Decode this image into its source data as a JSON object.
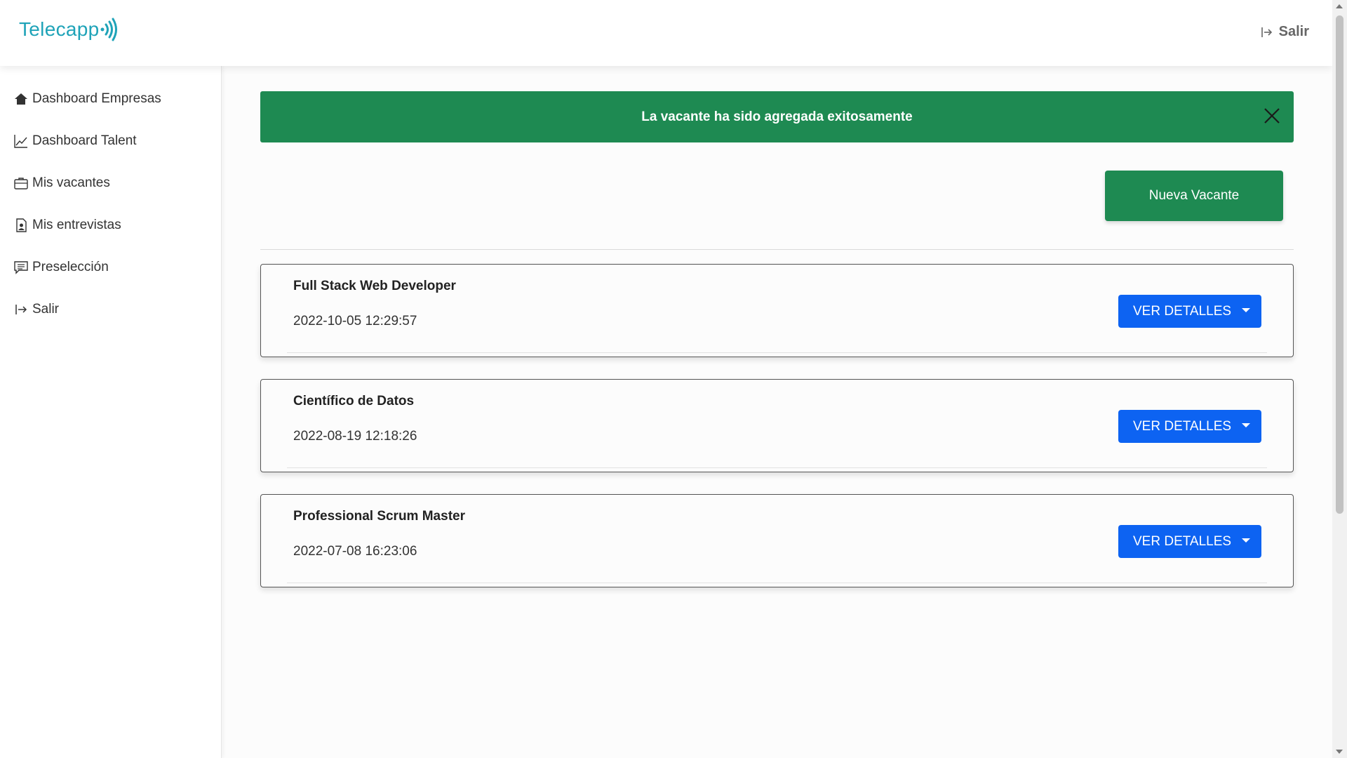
{
  "brand": {
    "name": "Telecapp",
    "color": "#1fa3b8"
  },
  "header": {
    "exit_label": "Salir"
  },
  "sidebar": {
    "items": [
      {
        "label": "Dashboard Empresas",
        "icon": "home-icon"
      },
      {
        "label": "Dashboard Talent",
        "icon": "line-chart-icon"
      },
      {
        "label": "Mis vacantes",
        "icon": "briefcase-icon"
      },
      {
        "label": "Mis entrevistas",
        "icon": "document-person-icon"
      },
      {
        "label": "Preselección",
        "icon": "chat-list-icon"
      },
      {
        "label": "Salir",
        "icon": "exit-icon"
      }
    ]
  },
  "alert": {
    "message": "La vacante ha sido agregada exitosamente",
    "color": "#1e8a52"
  },
  "actions": {
    "new_vacancy_label": "Nueva Vacante"
  },
  "vacancies": [
    {
      "title": "Full Stack Web Developer",
      "date": "2022-10-05 12:29:57",
      "button_label": "VER DETALLES"
    },
    {
      "title": "Científico de Datos",
      "date": "2022-08-19 12:18:26",
      "button_label": "VER DETALLES"
    },
    {
      "title": "Professional Scrum Master",
      "date": "2022-07-08 16:23:06",
      "button_label": "VER DETALLES"
    }
  ],
  "colors": {
    "primary_button": "#0d63f2",
    "success": "#1e8a52"
  }
}
